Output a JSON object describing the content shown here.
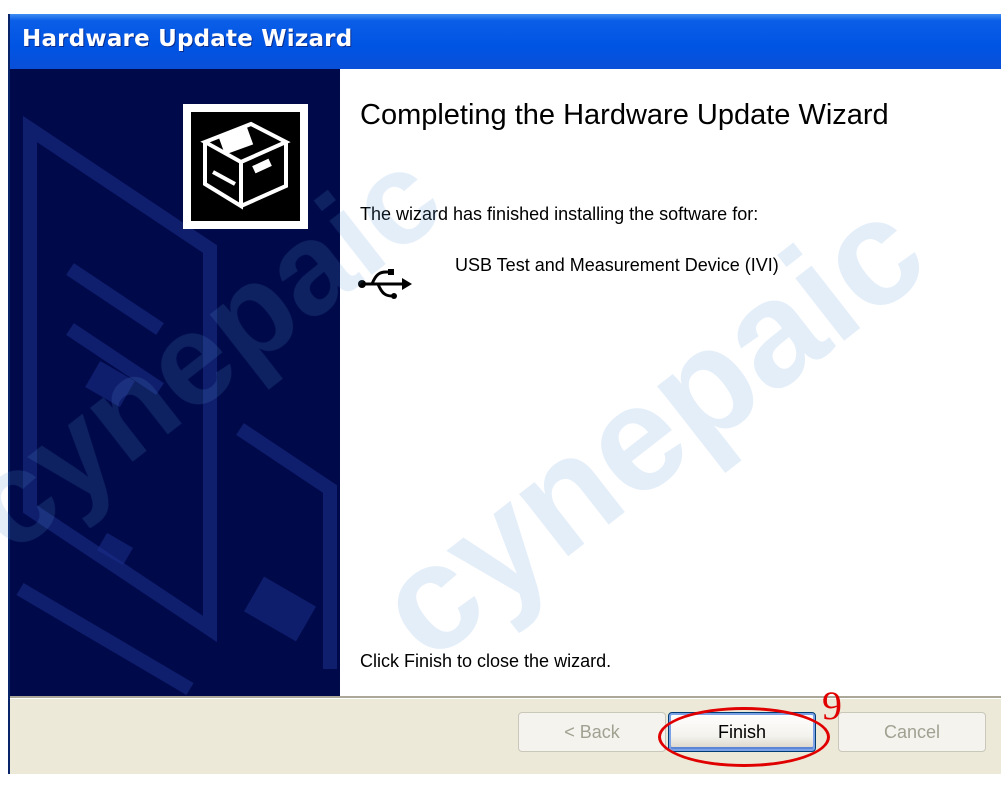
{
  "window": {
    "title": "Hardware Update Wizard"
  },
  "content": {
    "heading": "Completing the Hardware Update Wizard",
    "intro": "The wizard has finished installing the software for:",
    "device_name": "USB Test and Measurement Device (IVI)",
    "footer": "Click Finish to close the wizard."
  },
  "buttons": {
    "back": "< Back",
    "finish": "Finish",
    "cancel": "Cancel"
  },
  "annotation": {
    "step_number": "9",
    "color": "#e00000"
  },
  "watermark": {
    "text": "cynepaic"
  },
  "icons": {
    "hardware": "hardware-drive-icon",
    "device": "usb-icon"
  },
  "colors": {
    "titlebar": "#0054e3",
    "side_panel": "#000a4a",
    "dialog_bg": "#ece9d8"
  }
}
